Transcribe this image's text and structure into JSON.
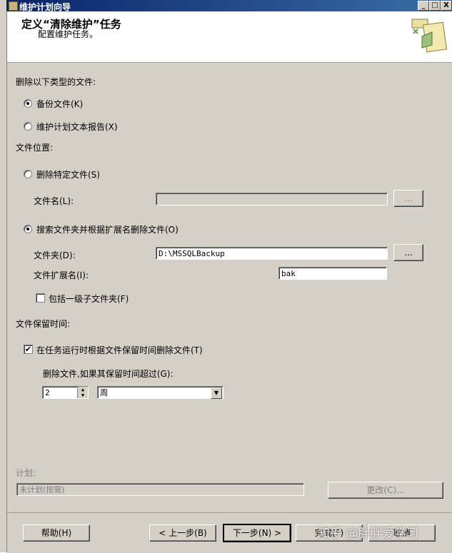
{
  "window": {
    "title": "维护计划向导",
    "btn_min": "_",
    "btn_max": "□",
    "btn_close": "X"
  },
  "header": {
    "title": "定义“清除维护”任务",
    "subtitle": "配置维护任务。"
  },
  "delete_type": {
    "label": "删除以下类型的文件:",
    "options": [
      "备份文件(K)",
      "维护计划文本报告(X)"
    ],
    "selected": 0
  },
  "file_location": {
    "label": "文件位置:",
    "specific": {
      "label": "删除特定文件(S)",
      "filename_label": "文件名(L):",
      "filename_value": "",
      "browse_label": "..."
    },
    "search": {
      "label": "搜索文件夹并根据扩展名删除文件(O)",
      "folder_label": "文件夹(D):",
      "folder_value": "D:\\MSSQLBackup",
      "browse_label": "...",
      "ext_label": "文件扩展名(I):",
      "ext_value": "bak",
      "include_sub_label": "包括一级子文件夹(F)",
      "include_sub_checked": false
    }
  },
  "retention": {
    "label": "文件保留时间:",
    "check_label": "在任务运行时根据文件保留时间删除文件(T)",
    "checked": true,
    "older_label": "删除文件,如果其保留时间超过(G):",
    "amount": "2",
    "unit": "周",
    "spin_up": "▲",
    "spin_down": "▼",
    "dropdown_arrow": "▼"
  },
  "schedule": {
    "label": "计划:",
    "value": "未计划(按需)",
    "change_label": "更改(C)..."
  },
  "footer": {
    "help": "帮助(H)",
    "back": "< 上一步(B)",
    "next": "下一步(N) >",
    "finish": "完成(F)",
    "cancel": "取消"
  },
  "watermark": "知乎 @胖胖爱学习"
}
